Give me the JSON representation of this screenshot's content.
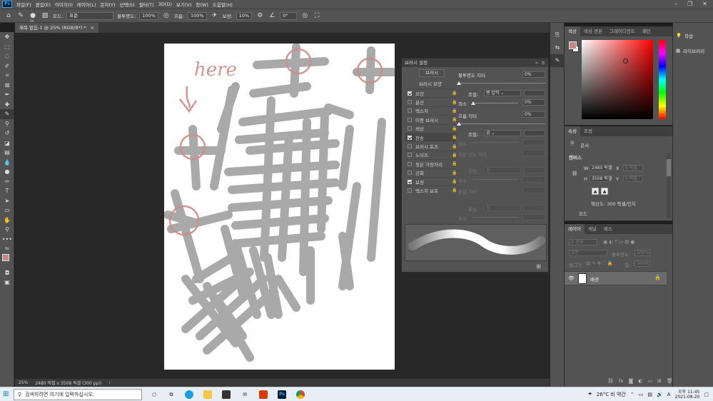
{
  "app": {
    "logo": "Ps"
  },
  "menu": [
    "파일(F)",
    "편집(E)",
    "이미지(I)",
    "레이어(L)",
    "문자(Y)",
    "선택(S)",
    "필터(T)",
    "3D(D)",
    "보기(V)",
    "창(W)",
    "도움말(H)"
  ],
  "options": {
    "brush_size": "30",
    "mode_label": "모드:",
    "mode_value": "표준",
    "opacity_label": "불투명도:",
    "opacity_value": "100%",
    "flow_label": "흐름:",
    "flow_value": "100%",
    "smoothing_label": "보정:",
    "smoothing_value": "10%",
    "angle_value": "0°"
  },
  "document": {
    "tab_title": "제목 없음-1 @ 25% (RGB/8*) *",
    "close": "×",
    "annotation": "here"
  },
  "status": {
    "zoom": "25%",
    "info": "2480 픽셀 x 3508 픽셀 (300 ppi)",
    "arrow": "›"
  },
  "brush_panel": {
    "title": "브러시 설정",
    "button": "브러시",
    "header": "브러시 모양",
    "rows": [
      {
        "label": "모양",
        "checked": true,
        "active": false
      },
      {
        "label": "분산",
        "checked": false,
        "active": false
      },
      {
        "label": "텍스처",
        "checked": false,
        "active": false
      },
      {
        "label": "이중 브러시",
        "checked": false,
        "active": false
      },
      {
        "label": "색상",
        "checked": false,
        "active": false
      },
      {
        "label": "전송",
        "checked": true,
        "active": true
      },
      {
        "label": "브러시 포즈",
        "checked": false,
        "active": false
      },
      {
        "label": "노이즈",
        "checked": false,
        "active": false
      },
      {
        "label": "젖은 가장자리",
        "checked": false,
        "active": false
      },
      {
        "label": "강화",
        "checked": false,
        "active": false
      },
      {
        "label": "보정",
        "checked": true,
        "active": false
      },
      {
        "label": "텍스처 보호",
        "checked": false,
        "active": false
      }
    ],
    "opacity_jitter_label": "불투명도 지터",
    "opacity_jitter_value": "0%",
    "control_label": "조절:",
    "control_value_1": "펜 압력",
    "min_label": "최소",
    "min_value_1": "0%",
    "flow_jitter_label": "흐름 지터",
    "flow_jitter_value": "0%",
    "control_value_2": "끔",
    "min_label_2": "최소",
    "wet_jitter_label": "젖은 양도 지터",
    "control_label_3": "조절:",
    "control_value_3": "끔",
    "min_label_3": "최소",
    "mix_jitter_label": "혼합 지터",
    "control_label_4": "조절:",
    "control_value_4": "끔",
    "min_label_4": "최소"
  },
  "color_panel": {
    "tabs": [
      "색상",
      "색상 견본",
      "그레이디언트",
      "패턴"
    ],
    "active_tab": 0,
    "fg": "#c28a86",
    "bg": "#ffffff"
  },
  "properties_panel": {
    "tabs": [
      "속성",
      "조정"
    ],
    "doc_label": "문서",
    "canvas_label": "캔버스",
    "w_label": "W",
    "w_value": "2480 픽셀",
    "x_label": "X",
    "x_value": "0 픽셀",
    "h_label": "H",
    "h_value": "3508 픽셀",
    "y_label": "Y",
    "y_value": "0 픽셀",
    "resolution": "해상도: 300 픽셀/인치",
    "mode_label": "모드"
  },
  "layers_panel": {
    "tabs": [
      "레이어",
      "채널",
      "패스"
    ],
    "kind_label": "종류",
    "blend_mode": "표준",
    "opacity_label": "불투명도:",
    "opacity_value": "100%",
    "lock_label": "잠그기:",
    "fill_label": "칠:",
    "fill_value": "100%",
    "layer_name": "배경"
  },
  "far_right": {
    "learn": "학습",
    "libraries": "라이브러리"
  },
  "taskbar": {
    "search_placeholder": "검색하려면 여기에 입력하십시오.",
    "weather": "26°C 비 약간",
    "ime": "A",
    "time": "오후 11:45",
    "date": "2021-08-20"
  }
}
